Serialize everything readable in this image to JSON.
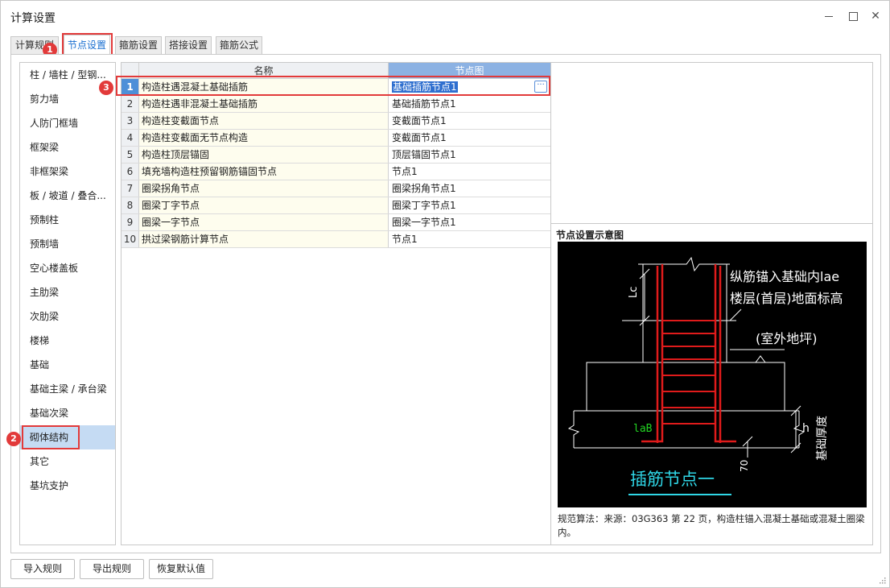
{
  "window": {
    "title": "计算设置"
  },
  "tabs": [
    {
      "label": "计算规则"
    },
    {
      "label": "节点设置"
    },
    {
      "label": "箍筋设置"
    },
    {
      "label": "搭接设置"
    },
    {
      "label": "箍筋公式"
    }
  ],
  "badges": {
    "b1": "1",
    "b2": "2",
    "b3": "3"
  },
  "sidebar": {
    "items": [
      {
        "label": "柱 / 墙柱 / 型钢..."
      },
      {
        "label": "剪力墙"
      },
      {
        "label": "人防门框墙"
      },
      {
        "label": "框架梁"
      },
      {
        "label": "非框架梁"
      },
      {
        "label": "板 / 坡道 / 叠合..."
      },
      {
        "label": "预制柱"
      },
      {
        "label": "预制墙"
      },
      {
        "label": "空心楼盖板"
      },
      {
        "label": "主肋梁"
      },
      {
        "label": "次肋梁"
      },
      {
        "label": "楼梯"
      },
      {
        "label": "基础"
      },
      {
        "label": "基础主梁 / 承台梁"
      },
      {
        "label": "基础次梁"
      },
      {
        "label": "砌体结构"
      },
      {
        "label": "其它"
      },
      {
        "label": "基坑支护"
      }
    ],
    "selected_index": 15
  },
  "grid": {
    "headers": {
      "name": "名称",
      "node": "节点图"
    },
    "rows": [
      {
        "num": "1",
        "name": "构造柱遇混凝土基础插筋",
        "node": "基础插筋节点1"
      },
      {
        "num": "2",
        "name": "构造柱遇非混凝土基础插筋",
        "node": "基础插筋节点1"
      },
      {
        "num": "3",
        "name": "构造柱变截面节点",
        "node": "变截面节点1"
      },
      {
        "num": "4",
        "name": "构造柱变截面无节点构造",
        "node": "变截面节点1"
      },
      {
        "num": "5",
        "name": "构造柱顶层锚固",
        "node": "顶层锚固节点1"
      },
      {
        "num": "6",
        "name": "填充墙构造柱预留钢筋锚固节点",
        "node": "节点1"
      },
      {
        "num": "7",
        "name": "圈梁拐角节点",
        "node": "圈梁拐角节点1"
      },
      {
        "num": "8",
        "name": "圈梁丁字节点",
        "node": "圈梁丁字节点1"
      },
      {
        "num": "9",
        "name": "圈梁一字节点",
        "node": "圈梁一字节点1"
      },
      {
        "num": "10",
        "name": "拱过梁钢筋计算节点",
        "node": "节点1"
      }
    ],
    "ellipsis": "···"
  },
  "preview": {
    "title": "节点设置示意图",
    "diagram": {
      "label_top": "纵筋锚入基础内lae",
      "label_floor": "楼层(首层)地面标高",
      "label_outdoor": "(室外地坪)",
      "label_lc": "Lc",
      "label_lab": "laB",
      "label_h": "h",
      "label_thickness": "基础厚度",
      "label_70": "70",
      "caption": "插筋节点一"
    },
    "description": "规范算法：来源：03G363 第 22 页，构造柱锚入混凝土基础或混凝土圈梁内。"
  },
  "footer": {
    "import": "导入规则",
    "export": "导出规则",
    "restore": "恢复默认值"
  },
  "colors": {
    "accent": "#1a6fd0",
    "highlight": "#e23a3a",
    "selected_row": "#c5dbf3"
  }
}
